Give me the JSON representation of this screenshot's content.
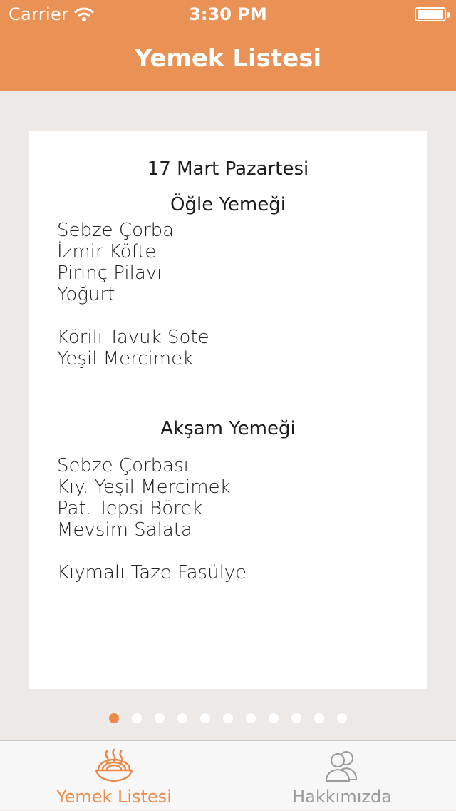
{
  "status_bar": {
    "carrier": "Carrier",
    "time": "3:30 PM"
  },
  "nav": {
    "title": "Yemek Listesi"
  },
  "menu": {
    "date": "17 Mart Pazartesi",
    "lunch": {
      "title": "Öğle Yemeği",
      "items": [
        "Sebze Çorba",
        "İzmir Köfte",
        "Pirinç Pilavı",
        "Yoğurt"
      ],
      "alt_items": [
        "Körili Tavuk Sote",
        "Yeşil Mercimek"
      ]
    },
    "dinner": {
      "title": "Akşam Yemeği",
      "items": [
        "Sebze Çorbası",
        "Kıy. Yeşil Mercimek",
        "Pat. Tepsi Börek",
        "Mevsim Salata"
      ],
      "alt_items": [
        "Kıymalı Taze Fasülye"
      ]
    }
  },
  "pagination": {
    "total": 11,
    "current": 1
  },
  "tabs": [
    {
      "label": "Yemek Listesi",
      "icon": "food-bowl-icon",
      "selected": true
    },
    {
      "label": "Hakkımızda",
      "icon": "people-icon",
      "selected": false
    }
  ],
  "colors": {
    "accent": "#ea9155",
    "background": "#ece9e6",
    "card": "#ffffff"
  }
}
